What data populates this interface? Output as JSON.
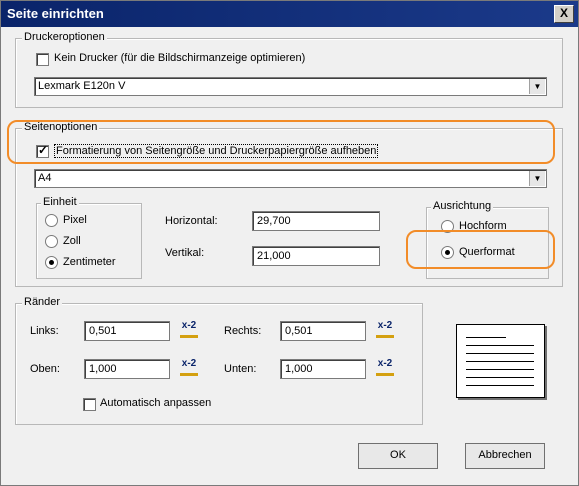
{
  "window": {
    "title": "Seite einrichten",
    "close_label": "X"
  },
  "printer_options": {
    "group_label": "Druckeroptionen",
    "no_printer_label": "Kein Drucker (für die Bildschirmanzeige optimieren)",
    "no_printer_checked": false,
    "printer_selected": "Lexmark E120n V"
  },
  "page_options": {
    "group_label": "Seitenoptionen",
    "override_label": "Formatierung von Seitengröße und Druckerpapiergröße aufheben",
    "override_checked": true,
    "paper_selected": "A4",
    "unit": {
      "group_label": "Einheit",
      "options": [
        "Pixel",
        "Zoll",
        "Zentimeter"
      ],
      "selected": "Zentimeter"
    },
    "horizontal_label": "Horizontal:",
    "horizontal_value": "29,700",
    "vertical_label": "Vertikal:",
    "vertical_value": "21,000",
    "orientation": {
      "group_label": "Ausrichtung",
      "options": [
        "Hochform",
        "Querformat"
      ],
      "selected": "Querformat"
    }
  },
  "margins": {
    "group_label": "Ränder",
    "left_label": "Links:",
    "left_value": "0,501",
    "right_label": "Rechts:",
    "right_value": "0,501",
    "top_label": "Oben:",
    "top_value": "1,000",
    "bottom_label": "Unten:",
    "bottom_value": "1,000",
    "auto_fit_label": "Automatisch anpassen",
    "auto_fit_checked": false,
    "spin_icon": "x-2"
  },
  "buttons": {
    "ok": "OK",
    "cancel": "Abbrechen"
  },
  "colors": {
    "highlight": "#f28c28",
    "title_bar": "#0a246a"
  }
}
